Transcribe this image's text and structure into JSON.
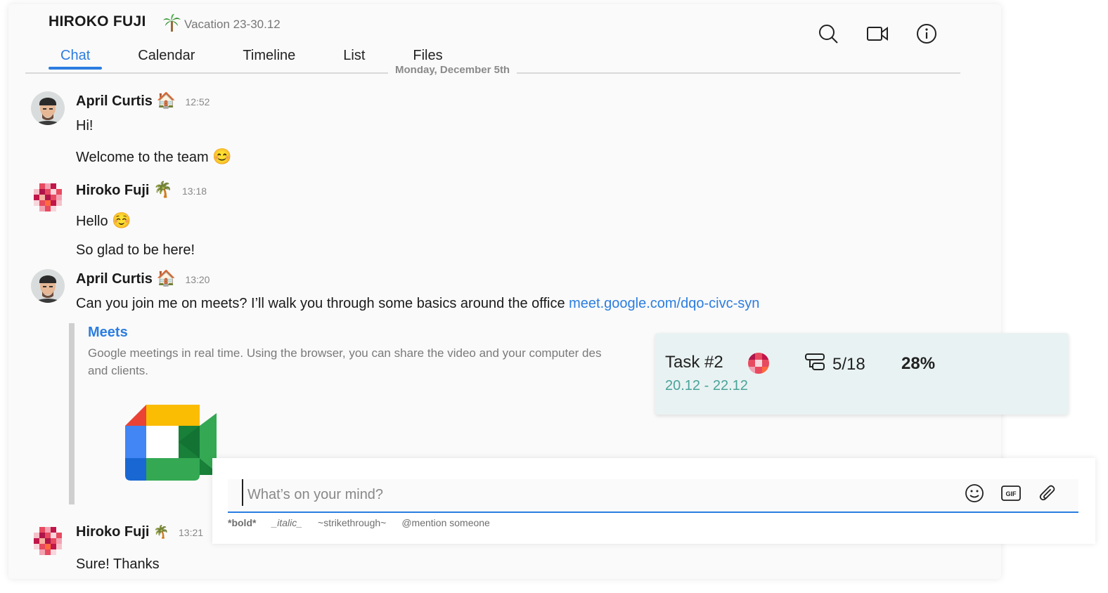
{
  "header": {
    "title": "HIROKO FUJI",
    "status_icon": "palm-tree-emoji",
    "status_text": "Vacation 23-30.12",
    "tabs": [
      {
        "label": "Chat",
        "active": true
      },
      {
        "label": "Calendar",
        "active": false
      },
      {
        "label": "Timeline",
        "active": false
      },
      {
        "label": "List",
        "active": false
      },
      {
        "label": "Files",
        "active": false
      }
    ],
    "icons": [
      "search-icon",
      "video-call-icon",
      "info-icon"
    ]
  },
  "chat": {
    "day_divider": "Monday, December 5th",
    "messages": [
      {
        "author": "April Curtis",
        "status_emoji": "🏠",
        "time": "12:52",
        "lines": [
          "Hi!",
          "Welcome to the team"
        ]
      },
      {
        "author": "Hiroko Fuji",
        "status_emoji": "🌴",
        "time": "13:18",
        "lines": [
          "Hello",
          "So glad to be here!"
        ]
      },
      {
        "author": "April Curtis",
        "status_emoji": "🏠",
        "time": "13:20",
        "lines": [
          "Can you join me on meets? I’ll walk you through some basics around the office"
        ],
        "link": "meet.google.com/dqo-civc-syn"
      },
      {
        "author": "Hiroko Fuji",
        "status_emoji": "🌴",
        "time": "13:21",
        "lines": [
          "Sure! Thanks"
        ]
      }
    ],
    "emojis": {
      "smile": "😊",
      "relieved": "☺️"
    },
    "link_preview": {
      "title": "Meets",
      "description": "Google meetings in real time. Using the browser, you can share the video and your computer des",
      "description_cont": "and clients."
    }
  },
  "task_card": {
    "name": "Task #2",
    "subtasks": "5/18",
    "progress": "28%",
    "dates": "20.12 - 22.12"
  },
  "composer": {
    "placeholder": "What’s on your mind?",
    "hints": [
      "*bold*",
      "_italic_",
      "~strikethrough~",
      "@mention someone"
    ],
    "icons": [
      "emoji-icon",
      "gif-icon",
      "attachment-icon"
    ]
  },
  "colors": {
    "accent": "#2b7de0",
    "task_bg": "#e9f2f2",
    "task_date": "#4aa39a"
  }
}
